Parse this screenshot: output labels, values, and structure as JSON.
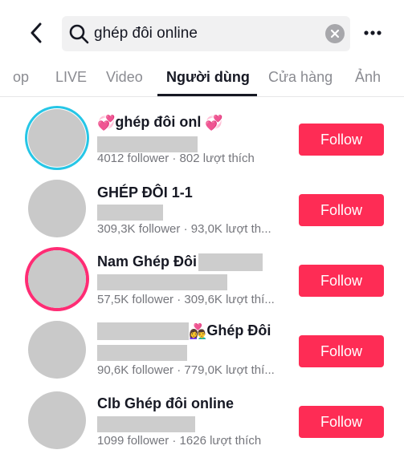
{
  "search": {
    "query": "ghép đôi online"
  },
  "tabs": [
    {
      "label": "op"
    },
    {
      "label": "LIVE"
    },
    {
      "label": "Video"
    },
    {
      "label": "Người dùng"
    },
    {
      "label": "Cửa hàng"
    },
    {
      "label": "Ảnh"
    }
  ],
  "users": [
    {
      "name": "ghép đôi onl",
      "stats": "4012 follower · 802 lượt thích",
      "follow_label": "Follow",
      "ring": "blue"
    },
    {
      "name": "GHÉP ĐÔI 1-1",
      "stats": "309,3K follower · 93,0K lượt th...",
      "follow_label": "Follow",
      "ring": "none"
    },
    {
      "name": "Nam Ghép Đôi",
      "stats": "57,5K follower · 309,6K lượt thí...",
      "follow_label": "Follow",
      "ring": "pink"
    },
    {
      "name": "Ghép Đôi",
      "stats": "90,6K follower · 779,0K lượt thí...",
      "follow_label": "Follow",
      "ring": "none"
    },
    {
      "name": "Clb Ghép đôi online",
      "stats": "1099 follower · 1626 lượt thích",
      "follow_label": "Follow",
      "ring": "none"
    }
  ],
  "colors": {
    "accent": "#fe2c55",
    "ring_blue": "#26c6e6",
    "ring_pink": "#ff2c74"
  },
  "icons": [
    "back-chevron-icon",
    "search-icon",
    "clear-icon",
    "more-icon",
    "heart-emoji-icon",
    "couple-emoji-icon"
  ]
}
